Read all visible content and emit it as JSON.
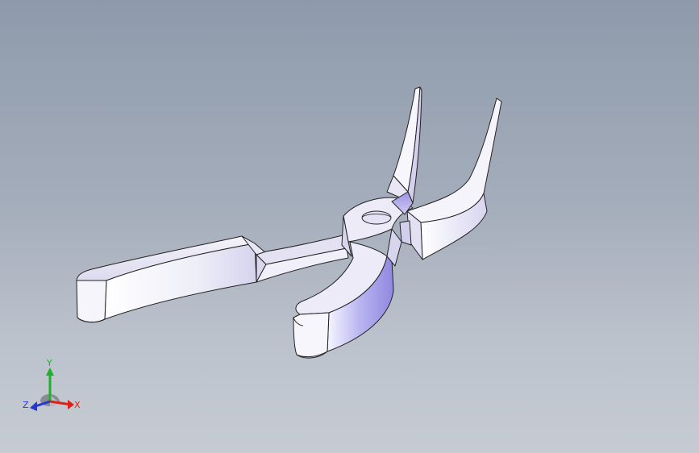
{
  "viewport": {
    "background_top": "#8e9aab",
    "background_bottom": "#c6cbd3"
  },
  "model": {
    "icon": "pliers-model",
    "face_color": "#eceaf6",
    "shade_color": "#bfbae8",
    "edge_color": "#222222"
  },
  "triad": {
    "x_label": "X",
    "y_label": "Y",
    "z_label": "Z",
    "x_color": "#e0201a",
    "y_color": "#1fb02a",
    "z_color": "#2538d0"
  }
}
